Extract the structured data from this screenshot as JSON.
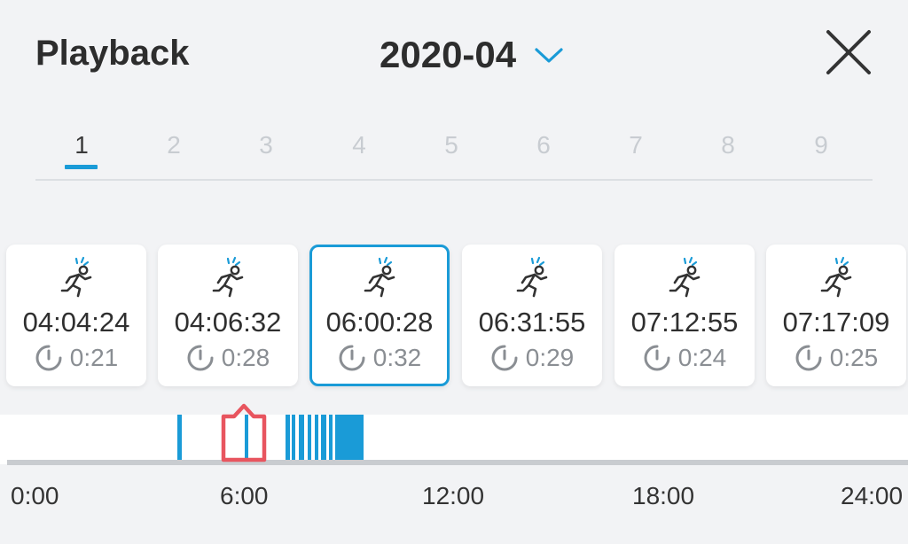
{
  "header": {
    "title": "Playback",
    "date": "2020-04",
    "dropdown_icon": "chevron-down-icon",
    "close_icon": "close-icon"
  },
  "tabs": [
    "1",
    "2",
    "3",
    "4",
    "5",
    "6",
    "7",
    "8",
    "9"
  ],
  "active_tab": "1",
  "events": [
    {
      "icon": "motion-runner-icon",
      "time": "04:04:24",
      "duration": "0:21",
      "selected": false
    },
    {
      "icon": "motion-runner-icon",
      "time": "04:06:32",
      "duration": "0:28",
      "selected": false
    },
    {
      "icon": "motion-runner-icon",
      "time": "06:00:28",
      "duration": "0:32",
      "selected": true
    },
    {
      "icon": "motion-runner-icon",
      "time": "06:31:55",
      "duration": "0:29",
      "selected": false
    },
    {
      "icon": "motion-runner-icon",
      "time": "07:12:55",
      "duration": "0:24",
      "selected": false
    },
    {
      "icon": "motion-runner-icon",
      "time": "07:17:09",
      "duration": "0:25",
      "selected": false
    }
  ],
  "timeline": {
    "ticks": [
      "0:00",
      "6:00",
      "12:00",
      "18:00",
      "24:00"
    ],
    "marker_time": "06:00:28"
  },
  "colors": {
    "accent": "#1a9bd7",
    "marker": "#e8555f",
    "background": "#f2f3f5",
    "card": "#ffffff"
  }
}
